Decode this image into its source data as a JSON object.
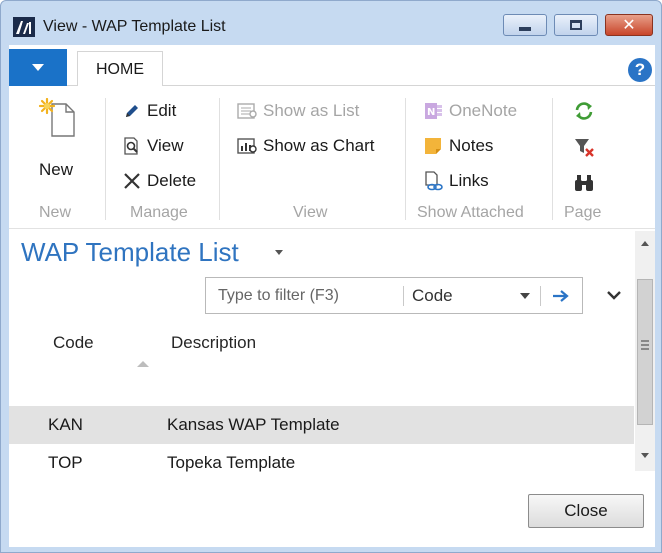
{
  "window": {
    "title": "View - WAP Template List",
    "icons": {
      "logo": "dynamics-nav-logo",
      "minimize": "minimize-icon",
      "maximize": "maximize-icon",
      "close": "close-icon"
    }
  },
  "ribbon": {
    "tabs": [
      {
        "label": "HOME",
        "active": true
      }
    ],
    "help_icon": "help-icon",
    "help_glyph": "?",
    "groups": {
      "new": {
        "label": "New",
        "new_label": "New"
      },
      "manage": {
        "label": "Manage",
        "edit_label": "Edit",
        "view_label": "View",
        "delete_label": "Delete"
      },
      "view": {
        "label": "View",
        "show_as_list_label": "Show as List",
        "show_as_chart_label": "Show as Chart"
      },
      "show_attached": {
        "label": "Show Attached",
        "onenote_label": "OneNote",
        "notes_label": "Notes",
        "links_label": "Links"
      },
      "page": {
        "label": "Page",
        "refresh_icon": "refresh-icon",
        "clear_filter_icon": "clear-filter-icon",
        "find_icon": "binoculars-icon"
      }
    }
  },
  "list": {
    "title": "WAP Template List",
    "filter": {
      "placeholder": "Type to filter (F3)",
      "value": "",
      "field": "Code"
    },
    "columns": [
      {
        "label": "Code",
        "sorted": "ascending"
      },
      {
        "label": "Description"
      }
    ],
    "rows": [
      {
        "code": "KAN",
        "description": "Kansas WAP Template",
        "selected": true
      },
      {
        "code": "TOP",
        "description": "Topeka Template",
        "selected": false
      }
    ]
  },
  "footer": {
    "close_label": "Close"
  },
  "colors": {
    "accent": "#1a72c8",
    "title_blue": "#2f74c0",
    "selected_row": "#e2e2e2",
    "frame": "#c6daf1",
    "disabled": "#a5a5a5"
  }
}
